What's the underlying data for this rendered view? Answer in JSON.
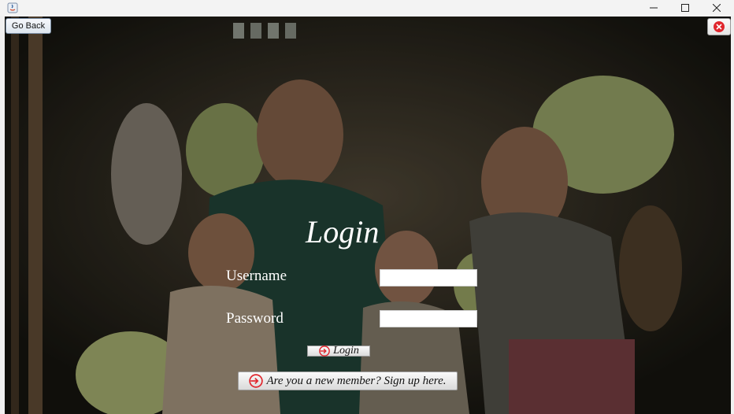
{
  "window": {
    "icons": [
      "java-app-icon",
      "minimize-icon",
      "maximize-icon",
      "close-icon"
    ]
  },
  "toolbar": {
    "go_back_label": "Go Back",
    "close_icon": "red-circle-x-icon"
  },
  "login": {
    "title": "Login",
    "username_label": "Username",
    "username_value": "",
    "password_label": "Password",
    "password_value": "",
    "login_button_label": "Login",
    "login_button_icon": "red-arrow-circle-icon",
    "signup_label": "Are you a new member? Sign up here.",
    "signup_icon": "red-arrow-circle-icon"
  },
  "colors": {
    "background_photo_dark": "#1b1a14",
    "text": "#ffffff",
    "icon_accent": "#e0262d"
  }
}
